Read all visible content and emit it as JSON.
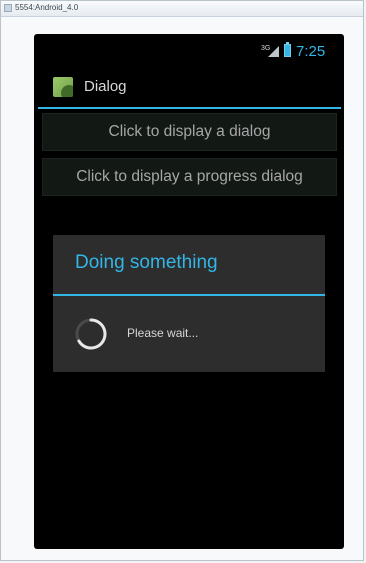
{
  "window": {
    "title": "5554:Android_4.0"
  },
  "status_bar": {
    "network": "3G",
    "time": "7:25"
  },
  "action_bar": {
    "title": "Dialog"
  },
  "buttons": {
    "display_dialog": "Click to display a dialog",
    "display_progress_dialog": "Click to display a progress dialog"
  },
  "progress_dialog": {
    "title": "Doing something",
    "message": "Please wait..."
  },
  "colors": {
    "accent": "#33b5e5",
    "screen_background": "#000000",
    "dialog_background": "#2d2d2d",
    "button_background": "#121814"
  }
}
